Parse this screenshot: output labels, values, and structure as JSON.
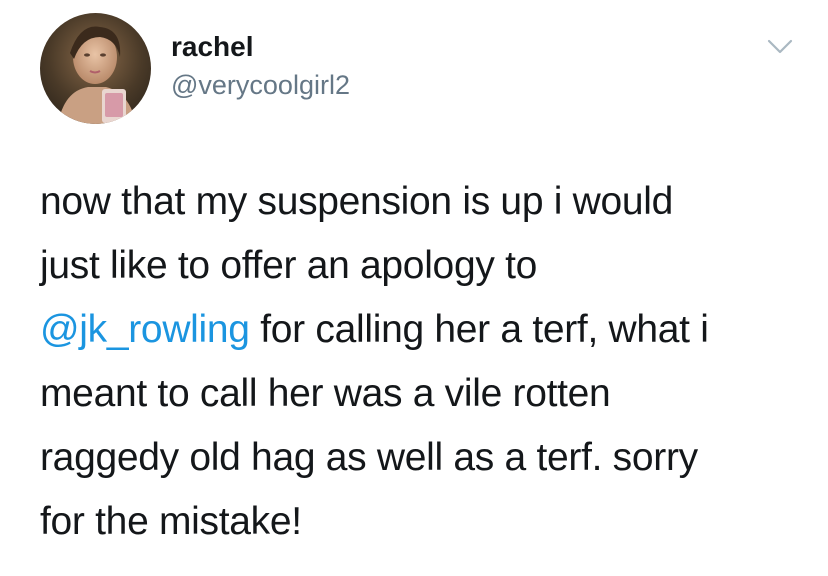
{
  "tweet": {
    "author": {
      "display_name": "rachel",
      "handle": "@verycoolgirl2",
      "avatar_icon": "profile-photo"
    },
    "menu_icon": "chevron-down-icon",
    "colors": {
      "text": "#14171a",
      "secondary": "#657786",
      "link": "#1b95e0",
      "caret": "#aab8c2"
    },
    "body": {
      "line1": "now that my suspension is up i would",
      "line2": "just like to offer an apology to",
      "mention": "@jk_rowling",
      "line3_rest": " for calling her a terf, what i",
      "line4": "meant to call her was a vile rotten",
      "line5": "raggedy old hag as well as a terf. sorry",
      "line6": "for the mistake!"
    }
  }
}
